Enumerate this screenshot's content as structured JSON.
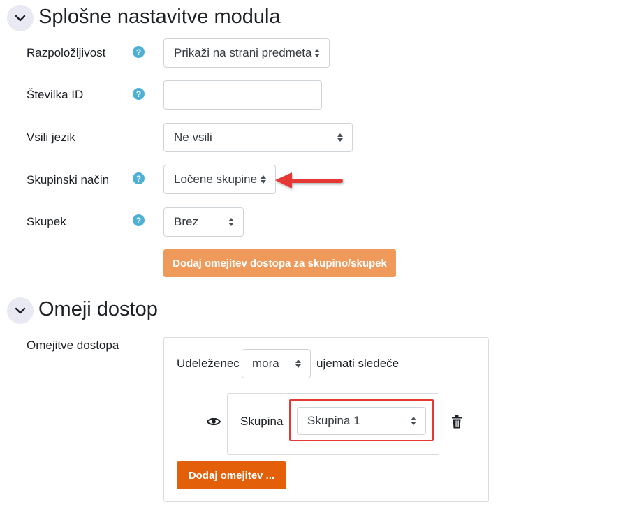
{
  "colors": {
    "section_toggle_bg": "#e9e9f3",
    "help_icon": "#4fb0d6",
    "add_group_button": "#ef9a5b",
    "add_restriction_button": "#e45f0a",
    "highlight_red": "#e53935"
  },
  "general_section": {
    "title": "Splošne nastavitve modula",
    "toggle_icon": "chevron-down-icon",
    "fields": {
      "availability": {
        "label": "Razpoložljivost",
        "value": "Prikaži na strani predmeta",
        "help_icon": "question-mark-icon"
      },
      "id_number": {
        "label": "Številka ID",
        "value": "",
        "help_icon": "question-mark-icon"
      },
      "force_language": {
        "label": "Vsili jezik",
        "value": "Ne vsili"
      },
      "group_mode": {
        "label": "Skupinski način",
        "value": "Ločene skupine",
        "help_icon": "question-mark-icon"
      },
      "grouping": {
        "label": "Skupek",
        "value": "Brez",
        "help_icon": "question-mark-icon"
      }
    },
    "add_group_restriction_button": "Dodaj omejitev dostopa za skupino/skupek"
  },
  "restrict_section": {
    "title": "Omeji dostop",
    "toggle_icon": "chevron-down-icon",
    "label": "Omejitve dostopa",
    "participant_text": "Udeleženec",
    "must_select": "mora",
    "match_text": "ujemati sledeče",
    "condition": {
      "label": "Skupina",
      "value": "Skupina 1",
      "eye_icon": "eye-icon",
      "delete_icon": "trash-icon"
    },
    "add_restriction_button": "Dodaj omejitev ..."
  },
  "annotations": {
    "arrow_icon": "red-arrow-icon"
  }
}
